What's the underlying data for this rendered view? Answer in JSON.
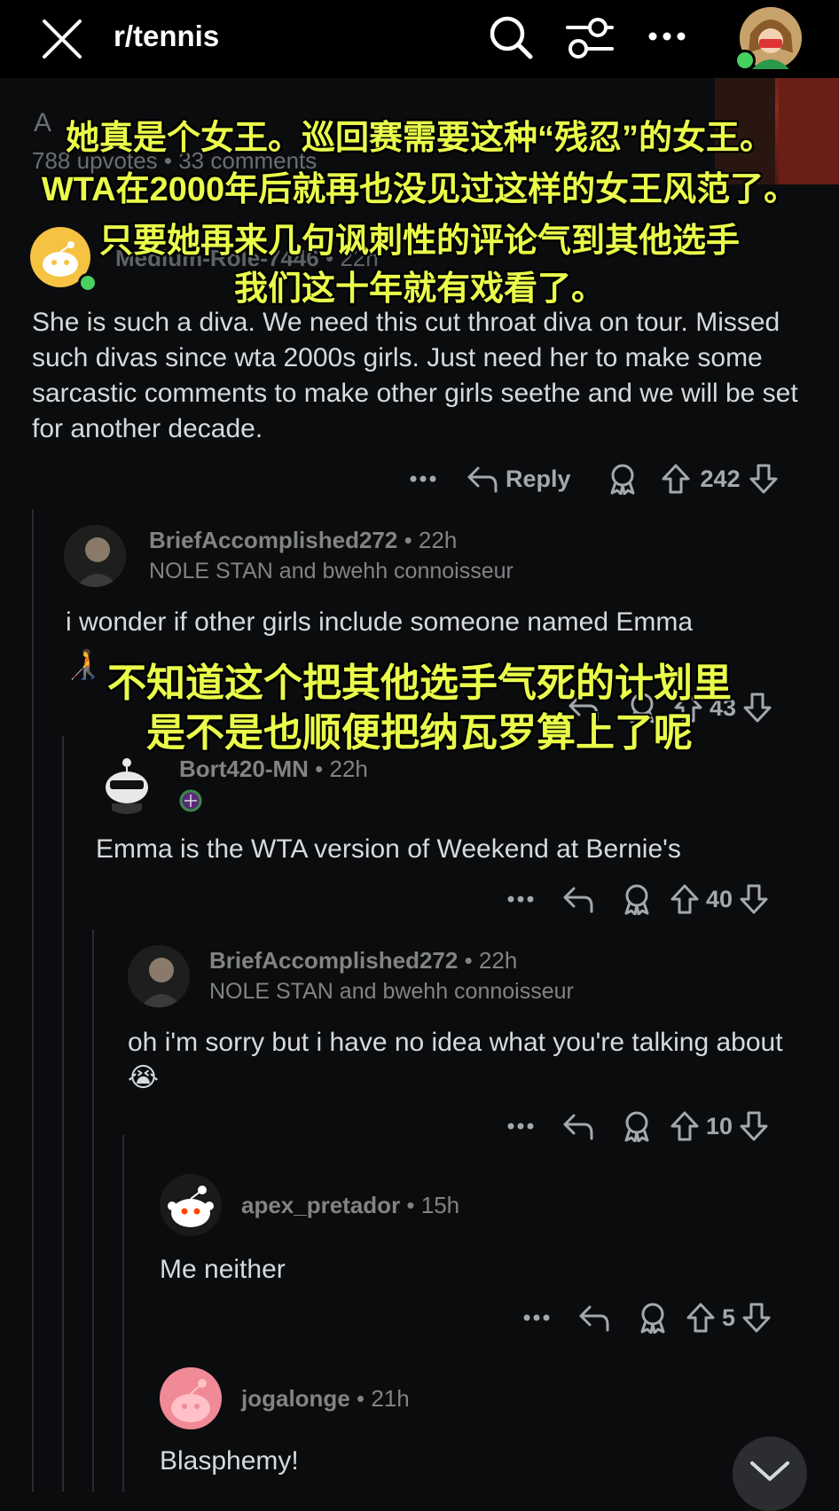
{
  "topbar": {
    "subreddit": "r/tennis"
  },
  "post": {
    "title_fragment": "A",
    "stats": "788 upvotes • 33 comments"
  },
  "overlay": {
    "line1": "她真是个女王。巡回赛需要这种“残忍”的女王。",
    "line2": "WTA在2000年后就再也没见过这样的女王风范了。",
    "line3": "只要她再来几句讽刺性的评论气到其他选手",
    "line4": "我们这十年就有戏看了。",
    "line5": "不知道这个把其他选手气死的计划里",
    "line6": "是不是也顺便把纳瓦罗算上了呢"
  },
  "comments": [
    {
      "user": "Medium-Role-7446",
      "age": "22h",
      "body": "She is such a diva. We need this cut throat diva on tour. Missed such divas since wta 2000s girls. Just need her to make some sarcastic comments to make other girls seethe and we will be set for another decade.",
      "reply_label": "Reply",
      "score": "242"
    },
    {
      "user": "BriefAccomplished272",
      "age": "22h",
      "flair": "NOLE STAN and bwehh connoisseur",
      "body": "i wonder if other girls include someone named Emma",
      "score": "43"
    },
    {
      "user": "Bort420-MN",
      "age": "22h",
      "body": "Emma is the WTA version of Weekend at Bernie's",
      "score": "40"
    },
    {
      "user": "BriefAccomplished272",
      "age": "22h",
      "flair": "NOLE STAN and bwehh connoisseur",
      "body": "oh i'm sorry but i have no idea what you're talking about 😭",
      "score": "10"
    },
    {
      "user": "apex_pretador",
      "age": "15h",
      "body": "Me neither",
      "score": "5"
    },
    {
      "user": "jogalonge",
      "age": "21h",
      "body": "Blasphemy!"
    }
  ],
  "dot": "•",
  "colors": {
    "background": "#0b0c0e",
    "text": "#d7dadc",
    "muted": "#818384",
    "overlay_text": "#eafc4a",
    "online": "#46d160"
  }
}
